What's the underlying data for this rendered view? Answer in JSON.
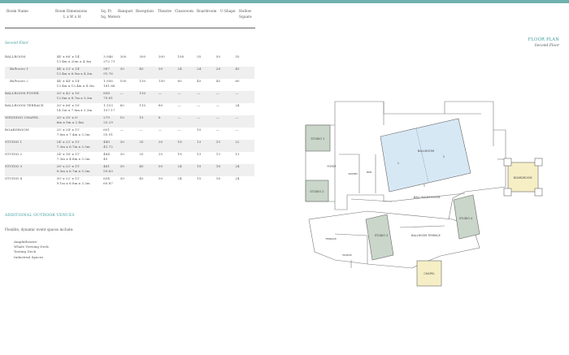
{
  "headers": {
    "room_name": "Room Name",
    "room_dimensions": [
      "Room Dimensions",
      "L x W x H"
    ],
    "sq_ft": [
      "Sq. Ft",
      "Sq. Meters"
    ],
    "banquet": "Banquet",
    "reception": "Reception",
    "theatre": "Theatre",
    "classroom": "Classroom",
    "boardroom": "Boardroom",
    "u_shape": "U-Shape",
    "hollow_square": [
      "Hollow",
      "Square"
    ]
  },
  "section_title": "Second Floor",
  "floorplan": {
    "title": "FLOOR PLAN",
    "subtitle": "Second Floor"
  },
  "rooms": [
    {
      "name": "BALLROOM",
      "sub": false,
      "dim1": "44' x 66' x 14'",
      "dim2": "13.4m x 20m x 4.3m",
      "sqft": "3,946",
      "sqm": "372.71",
      "banquet": "300",
      "reception": "300",
      "theatre": "300",
      "classroom": "180",
      "boardroom": "55",
      "ushape": "50",
      "hollow": "55"
    },
    {
      "name": "Ballroom 1",
      "sub": true,
      "dim1": "44' x 23' x 14'",
      "dim2": "13.4m x 6.9m x 4.3m",
      "sqft": "987",
      "sqm": "91.76",
      "banquet": "30",
      "reception": "40",
      "theatre": "30",
      "classroom": "24",
      "boardroom": "24",
      "ushape": "28",
      "hollow": "43"
    },
    {
      "name": "Ballroom 2",
      "sub": true,
      "dim1": "44' x 44' x 14'",
      "dim2": "13.4m x 13.4m x 4.3m",
      "sqft": "1,956",
      "sqm": "181.86",
      "banquet": "100",
      "reception": "130",
      "theatre": "150",
      "classroom": "60",
      "boardroom": "45",
      "ushape": "45",
      "hollow": "60"
    },
    {
      "name": "BALLROOM FOYER",
      "sub": false,
      "dim1": "20' x 42' x 10'",
      "dim2": "12.8m x 8.7m x 3.3m",
      "sqft": "858",
      "sqm": "79.81",
      "banquet": "—",
      "reception": "130",
      "theatre": "—",
      "classroom": "—",
      "boardroom": "—",
      "ushape": "—",
      "hollow": "—"
    },
    {
      "name": "BALLROOM TERRACE",
      "sub": false,
      "dim1": "20' x 66' x 10'",
      "dim2": "14.1m x 7.8m x 3.3m",
      "sqft": "1,153",
      "sqm": "107.17",
      "banquet": "60",
      "reception": "110",
      "theatre": "80",
      "classroom": "—",
      "boardroom": "—",
      "ushape": "—",
      "hollow": "24"
    },
    {
      "name": "WEDDING CHAPEL",
      "sub": false,
      "dim1": "20' x 30' x 8'",
      "dim2": "6m x 9m x 2.4m",
      "sqft": "279",
      "sqm": "25.29",
      "banquet": "10",
      "reception": "15",
      "theatre": "8",
      "classroom": "—",
      "boardroom": "—",
      "ushape": "—",
      "hollow": "—"
    },
    {
      "name": "BOARDROOM",
      "sub": false,
      "dim1": "25' x 24' x 11'",
      "dim2": "7.6m x 7.4m x 3.3m",
      "sqft": "601",
      "sqm": "55.91",
      "banquet": "—",
      "reception": "—",
      "theatre": "—",
      "classroom": "—",
      "boardroom": "10",
      "ushape": "—",
      "hollow": "—"
    },
    {
      "name": "STUDIO 1",
      "sub": false,
      "dim1": "24' x 22' x 11'",
      "dim2": "7.3m x 6.7m x 3.3m",
      "sqft": "449",
      "sqm": "41.72",
      "banquet": "30",
      "reception": "35",
      "theatre": "30",
      "classroom": "18",
      "boardroom": "13",
      "ushape": "15",
      "hollow": "22"
    },
    {
      "name": "STUDIO 2",
      "sub": false,
      "dim1": "24' x 16' x 11'",
      "dim2": "7.3m x 4.8m x 3.3m",
      "sqft": "484",
      "sqm": "45",
      "banquet": "30",
      "reception": "35",
      "theatre": "35",
      "classroom": "18",
      "boardroom": "13",
      "ushape": "13",
      "hollow": "13"
    },
    {
      "name": "STUDIO 3",
      "sub": false,
      "dim1": "28' x 22' x 11'",
      "dim2": "8.5m x 6.7m x 3.3m",
      "sqft": "461",
      "sqm": "59.63",
      "banquet": "30",
      "reception": "40",
      "theatre": "50",
      "classroom": "24",
      "boardroom": "15",
      "ushape": "18",
      "hollow": "24"
    },
    {
      "name": "STUDIO 4",
      "sub": false,
      "dim1": "30' x 22' x 11'",
      "dim2": "9.1m x 6.8m x 3.3m",
      "sqft": "654",
      "sqm": "60.87",
      "banquet": "30",
      "reception": "40",
      "theatre": "50",
      "classroom": "24",
      "boardroom": "15",
      "ushape": "18",
      "hollow": "24"
    }
  ],
  "outdoor": {
    "title": "ADDITIONAL OUTDOOR VENUES",
    "text": "Flexible, dynamic event spaces include:",
    "items": [
      "Amphitheatre",
      "Whale Viewing Deck",
      "Tasting Deck",
      "Industrial Spaces"
    ]
  },
  "plan_labels": {
    "studio1": "STUDIO 1",
    "studio2": "STUDIO 2",
    "studio3": "STUDIO 3",
    "studio4": "STUDIO 4",
    "foyer": "FOYER",
    "ballroom": "BALLROOM",
    "ballroom_foyer": "BALL ROOM FOYER",
    "ballroom_terrace": "BALLROOM TERRACE",
    "boardroom": "BOARDROOM",
    "chapel": "CHAPEL",
    "terrace": "TERRACE",
    "ballroom_1": "1",
    "ballroom_2": "2",
    "small_a": "WOMEN",
    "small_b": "MEN",
    "small_c": "MUSEUM"
  },
  "colors": {
    "accent": "#3a9a99",
    "studio_fill": "#c9d6c9",
    "ballroom_fill": "#d7e8f5",
    "boardroom_fill": "#f6efc6"
  }
}
